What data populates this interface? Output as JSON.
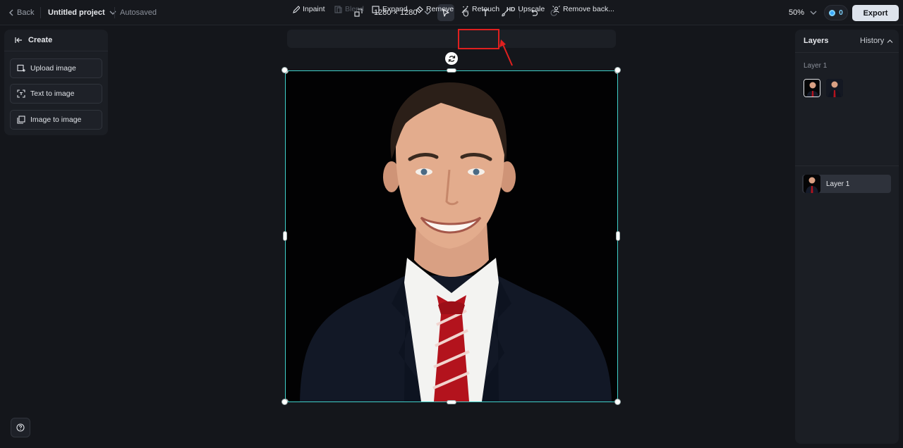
{
  "header": {
    "back_label": "Back",
    "project_name": "Untitled project",
    "save_status": "Autosaved",
    "canvas_size": "1280 × 1280",
    "zoom": "50%",
    "credits": "0",
    "export_label": "Export"
  },
  "create_panel": {
    "title": "Create",
    "items": [
      {
        "label": "Upload image"
      },
      {
        "label": "Text to image"
      },
      {
        "label": "Image to image"
      }
    ]
  },
  "edit_toolbar": {
    "items": [
      {
        "label": "Inpaint",
        "enabled": true
      },
      {
        "label": "Blend",
        "enabled": false
      },
      {
        "label": "Expand",
        "enabled": true
      },
      {
        "label": "Remove",
        "enabled": true
      },
      {
        "label": "Retouch",
        "enabled": true,
        "highlighted": true
      },
      {
        "label": "Upscale",
        "icon_text": "HD",
        "enabled": true
      },
      {
        "label": "Remove back...",
        "enabled": true
      }
    ]
  },
  "layers_panel": {
    "title": "Layers",
    "history_label": "History",
    "group_label": "Layer 1",
    "layers": [
      {
        "label": "Layer 1"
      }
    ]
  },
  "colors": {
    "selection": "#3fd0c9",
    "highlight": "#e0201f",
    "accent": "#3aa8ff"
  }
}
